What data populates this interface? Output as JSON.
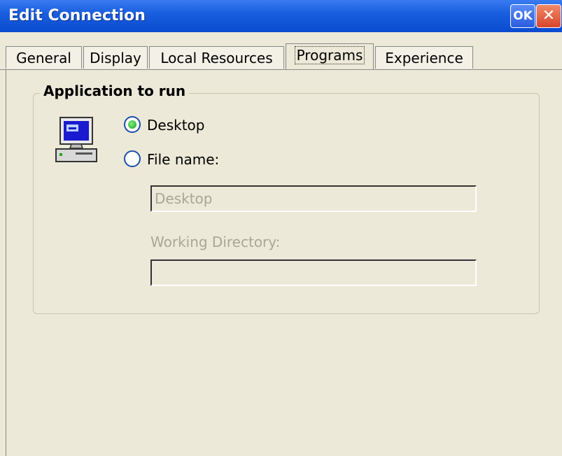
{
  "window": {
    "title": "Edit Connection",
    "ok_label": "OK",
    "close_glyph": "✕"
  },
  "tabs": [
    {
      "label": "General",
      "active": false
    },
    {
      "label": "Display",
      "active": false
    },
    {
      "label": "Local Resources",
      "active": false
    },
    {
      "label": "Programs",
      "active": true
    },
    {
      "label": "Experience",
      "active": false
    }
  ],
  "programs": {
    "group_title": "Application to run",
    "icon": "computer-icon",
    "radio_desktop": {
      "label": "Desktop",
      "checked": true
    },
    "radio_file": {
      "label": "File name:",
      "checked": false
    },
    "file_name_value": "Desktop",
    "working_dir_label": "Working Directory:",
    "working_dir_value": ""
  },
  "colors": {
    "titlebar": "#1a5fe0",
    "background": "#ece9d8",
    "disabled_text": "#a8a699"
  }
}
